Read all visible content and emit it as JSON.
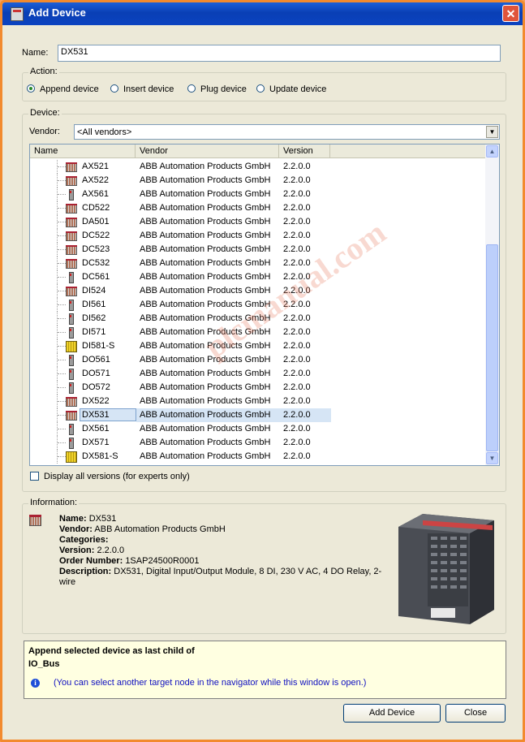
{
  "window": {
    "title": "Add Device",
    "close_glyph": "✕"
  },
  "name_field": {
    "label": "Name:",
    "value": "DX531"
  },
  "action": {
    "label": "Action:",
    "options": [
      {
        "label": "Append device",
        "selected": true
      },
      {
        "label": "Insert device",
        "selected": false
      },
      {
        "label": "Plug device",
        "selected": false
      },
      {
        "label": "Update device",
        "selected": false
      }
    ]
  },
  "device": {
    "label": "Device:",
    "vendor_label": "Vendor:",
    "vendor_value": "<All vendors>",
    "columns": [
      "Name",
      "Vendor",
      "Version"
    ],
    "rows": [
      {
        "name": "AX521",
        "vendor": "ABB Automation Products GmbH",
        "version": "2.2.0.0",
        "icon": "wide"
      },
      {
        "name": "AX522",
        "vendor": "ABB Automation Products GmbH",
        "version": "2.2.0.0",
        "icon": "wide"
      },
      {
        "name": "AX561",
        "vendor": "ABB Automation Products GmbH",
        "version": "2.2.0.0",
        "icon": "tall"
      },
      {
        "name": "CD522",
        "vendor": "ABB Automation Products GmbH",
        "version": "2.2.0.0",
        "icon": "wide"
      },
      {
        "name": "DA501",
        "vendor": "ABB Automation Products GmbH",
        "version": "2.2.0.0",
        "icon": "wide"
      },
      {
        "name": "DC522",
        "vendor": "ABB Automation Products GmbH",
        "version": "2.2.0.0",
        "icon": "wide"
      },
      {
        "name": "DC523",
        "vendor": "ABB Automation Products GmbH",
        "version": "2.2.0.0",
        "icon": "wide"
      },
      {
        "name": "DC532",
        "vendor": "ABB Automation Products GmbH",
        "version": "2.2.0.0",
        "icon": "wide"
      },
      {
        "name": "DC561",
        "vendor": "ABB Automation Products GmbH",
        "version": "2.2.0.0",
        "icon": "tall"
      },
      {
        "name": "DI524",
        "vendor": "ABB Automation Products GmbH",
        "version": "2.2.0.0",
        "icon": "wide"
      },
      {
        "name": "DI561",
        "vendor": "ABB Automation Products GmbH",
        "version": "2.2.0.0",
        "icon": "tall"
      },
      {
        "name": "DI562",
        "vendor": "ABB Automation Products GmbH",
        "version": "2.2.0.0",
        "icon": "tall"
      },
      {
        "name": "DI571",
        "vendor": "ABB Automation Products GmbH",
        "version": "2.2.0.0",
        "icon": "tall"
      },
      {
        "name": "DI581-S",
        "vendor": "ABB Automation Products GmbH",
        "version": "2.2.0.0",
        "icon": "yellow"
      },
      {
        "name": "DO561",
        "vendor": "ABB Automation Products GmbH",
        "version": "2.2.0.0",
        "icon": "tall"
      },
      {
        "name": "DO571",
        "vendor": "ABB Automation Products GmbH",
        "version": "2.2.0.0",
        "icon": "tall"
      },
      {
        "name": "DO572",
        "vendor": "ABB Automation Products GmbH",
        "version": "2.2.0.0",
        "icon": "tall"
      },
      {
        "name": "DX522",
        "vendor": "ABB Automation Products GmbH",
        "version": "2.2.0.0",
        "icon": "wide"
      },
      {
        "name": "DX531",
        "vendor": "ABB Automation Products GmbH",
        "version": "2.2.0.0",
        "icon": "wide",
        "selected": true
      },
      {
        "name": "DX561",
        "vendor": "ABB Automation Products GmbH",
        "version": "2.2.0.0",
        "icon": "tall"
      },
      {
        "name": "DX571",
        "vendor": "ABB Automation Products GmbH",
        "version": "2.2.0.0",
        "icon": "tall"
      },
      {
        "name": "DX581-S",
        "vendor": "ABB Automation Products GmbH",
        "version": "2.2.0.0",
        "icon": "yellow"
      }
    ],
    "display_all_versions": "Display all versions (for experts only)"
  },
  "information": {
    "label": "Information:",
    "name_key": "Name:",
    "name_val": "DX531",
    "vendor_key": "Vendor:",
    "vendor_val": "ABB Automation Products GmbH",
    "categories_key": "Categories:",
    "version_key": "Version:",
    "version_val": "2.2.0.0",
    "order_key": "Order Number:",
    "order_val": "1SAP24500R0001",
    "desc_key": "Description:",
    "desc_val": "DX531, Digital Input/Output Module, 8 DI, 230 V AC, 4 DO Relay, 2-wire"
  },
  "message": {
    "line1": "Append selected device as last child of",
    "line2": "IO_Bus",
    "hint": "(You can select another target node in the navigator while this window is open.)"
  },
  "buttons": {
    "add": "Add Device",
    "close": "Close"
  },
  "watermark": "plcmanual.com"
}
